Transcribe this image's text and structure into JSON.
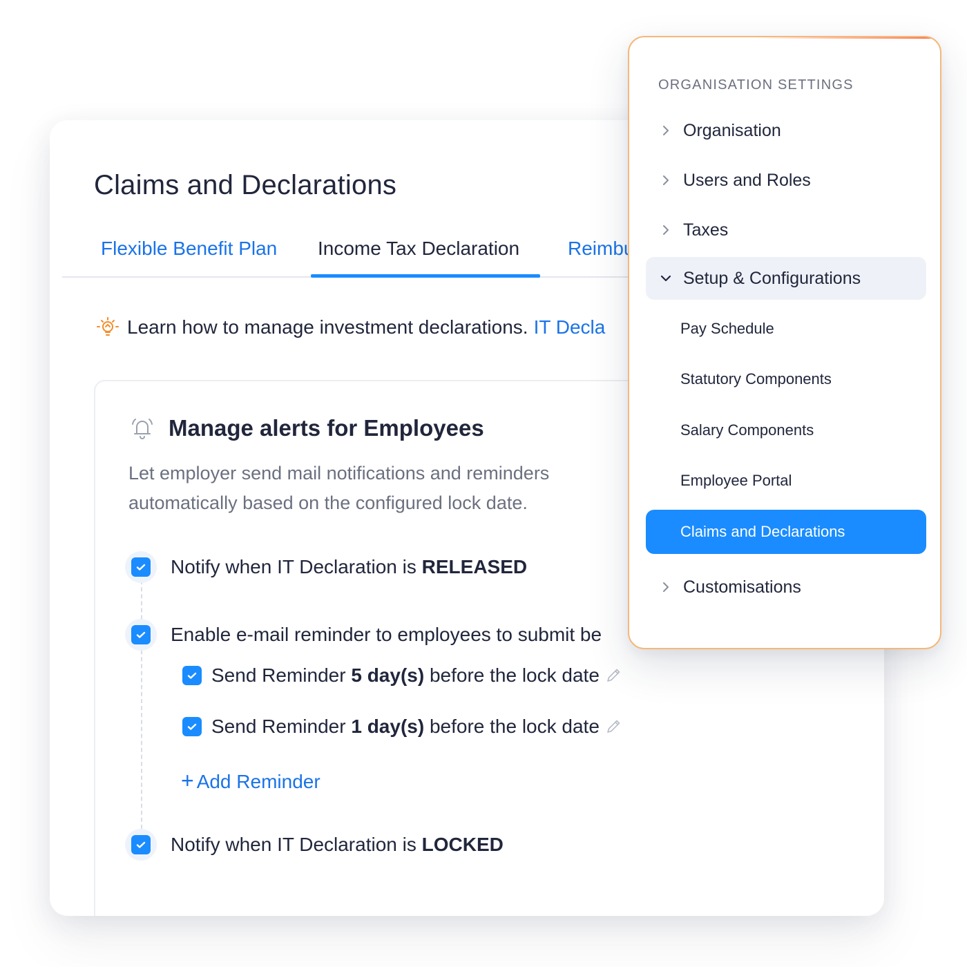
{
  "page": {
    "title": "Claims and Declarations"
  },
  "tabs": [
    {
      "label": "Flexible Benefit Plan",
      "active": false
    },
    {
      "label": "Income Tax Declaration",
      "active": true
    },
    {
      "label": "Reimbu",
      "active": false
    }
  ],
  "learn": {
    "text": "Learn how to manage investment declarations.",
    "link": "IT Decla"
  },
  "alerts": {
    "title": "Manage alerts for Employees",
    "description": "Let employer send mail notifications and reminders automatically based on the configured lock date.",
    "released": {
      "prefix": "Notify when IT Declaration is ",
      "status": "RELEASED",
      "checked": true
    },
    "email": {
      "label": "Enable e-mail reminder to employees to submit be",
      "checked": true
    },
    "reminders": [
      {
        "prefix": "Send Reminder ",
        "days": "5 day(s)",
        "suffix": " before the lock date",
        "checked": true
      },
      {
        "prefix": "Send Reminder ",
        "days": "1 day(s)",
        "suffix": " before the lock date",
        "checked": true
      }
    ],
    "add_reminder": "Add Reminder",
    "locked": {
      "prefix": "Notify when IT Declaration is ",
      "status": "LOCKED",
      "checked": true
    }
  },
  "settings_panel": {
    "heading": "ORGANISATION SETTINGS",
    "items": [
      {
        "label": "Organisation",
        "expanded": false
      },
      {
        "label": "Users and Roles",
        "expanded": false
      },
      {
        "label": "Taxes",
        "expanded": false
      },
      {
        "label": "Setup & Configurations",
        "expanded": true
      }
    ],
    "sub_items": [
      {
        "label": "Pay Schedule",
        "active": false
      },
      {
        "label": "Statutory Components",
        "active": false
      },
      {
        "label": "Salary Components",
        "active": false
      },
      {
        "label": "Employee Portal",
        "active": false
      },
      {
        "label": "Claims and Declarations",
        "active": true
      }
    ],
    "last_item": {
      "label": "Customisations",
      "expanded": false
    }
  },
  "colors": {
    "accent": "#1a8cff",
    "link": "#1a73e8",
    "text": "#21263c",
    "muted": "#6b7080",
    "panel_border": "#f4b87a"
  }
}
